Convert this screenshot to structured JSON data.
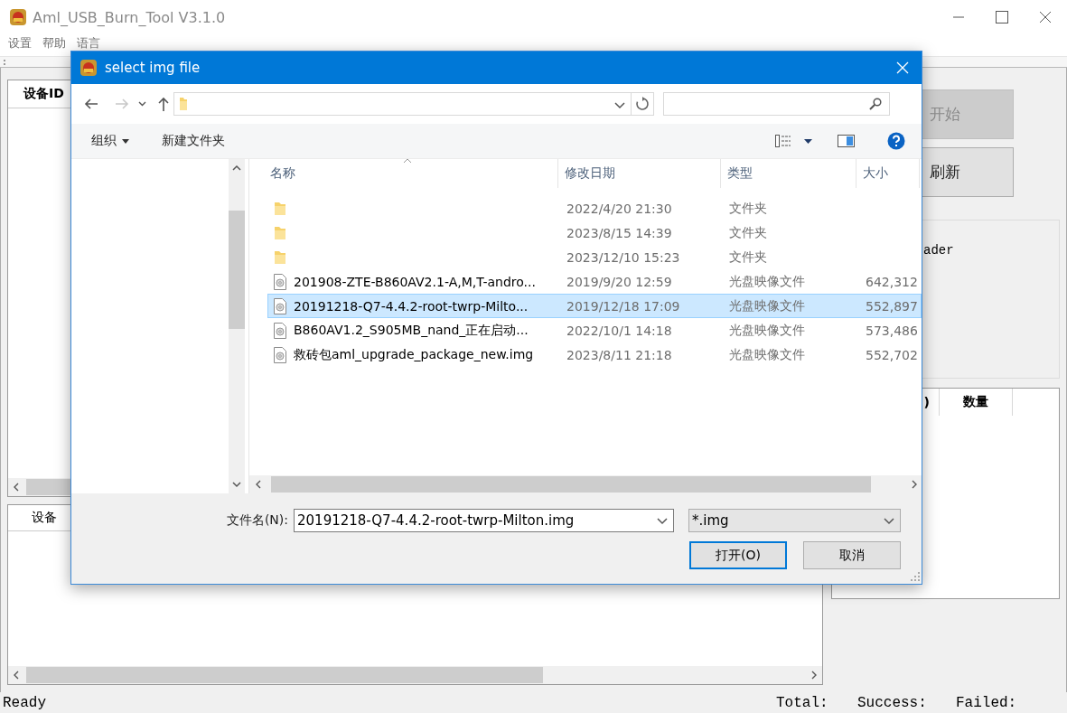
{
  "main_window": {
    "title": "Aml_USB_Burn_Tool V3.1.0",
    "menu": [
      "设置",
      "帮助",
      "语言"
    ],
    "device_table": {
      "columns": [
        "设备ID"
      ]
    },
    "device_list": {
      "columns": [
        "设备"
      ]
    },
    "buttons": [
      {
        "label": "开始",
        "disabled": true
      },
      {
        "label": "刷新",
        "disabled": false
      }
    ],
    "log_text": "ader",
    "summary_table": {
      "columns": [
        ")",
        "数量"
      ]
    },
    "status_bar": {
      "status": "Ready",
      "total": "Total:",
      "success": "Success:",
      "failed": "Failed:"
    }
  },
  "dialog": {
    "title": "select img file",
    "toolbar": {
      "organize": "组织",
      "new_folder": "新建文件夹"
    },
    "columns": [
      "名称",
      "修改日期",
      "类型",
      "大小"
    ],
    "files": [
      {
        "kind": "folder",
        "modified": "2022/4/20 21:30",
        "type": "文件夹",
        "selected": false
      },
      {
        "kind": "folder",
        "modified": "2023/8/15 14:39",
        "type": "文件夹",
        "selected": false
      },
      {
        "kind": "folder",
        "modified": "2023/12/10 15:23",
        "type": "文件夹",
        "selected": false
      },
      {
        "kind": "disc-image",
        "name": "201908-ZTE-B860AV2.1-A,M,T-andro...",
        "modified": "2019/9/20 12:59",
        "type": "光盘映像文件",
        "size": "642,312",
        "selected": false
      },
      {
        "kind": "disc-image",
        "name": "20191218-Q7-4.4.2-root-twrp-Milto...",
        "modified": "2019/12/18 17:09",
        "type": "光盘映像文件",
        "size": "552,897",
        "selected": true
      },
      {
        "kind": "disc-image",
        "name": "B860AV1.2_S905MB_nand_正在启动...",
        "modified": "2022/10/1 14:18",
        "type": "光盘映像文件",
        "size": "573,486",
        "selected": false
      },
      {
        "kind": "disc-image",
        "name": "救砖包aml_upgrade_package_new.img",
        "modified": "2023/8/11 21:18",
        "type": "光盘映像文件",
        "size": "552,702",
        "selected": false
      }
    ],
    "file_name_label": "文件名(N):",
    "file_name": "20191218-Q7-4.4.2-root-twrp-Milton.img",
    "filter": "*.img",
    "buttons": [
      {
        "label": "打开(O)",
        "default": true
      },
      {
        "label": "取消",
        "default": false
      }
    ]
  }
}
